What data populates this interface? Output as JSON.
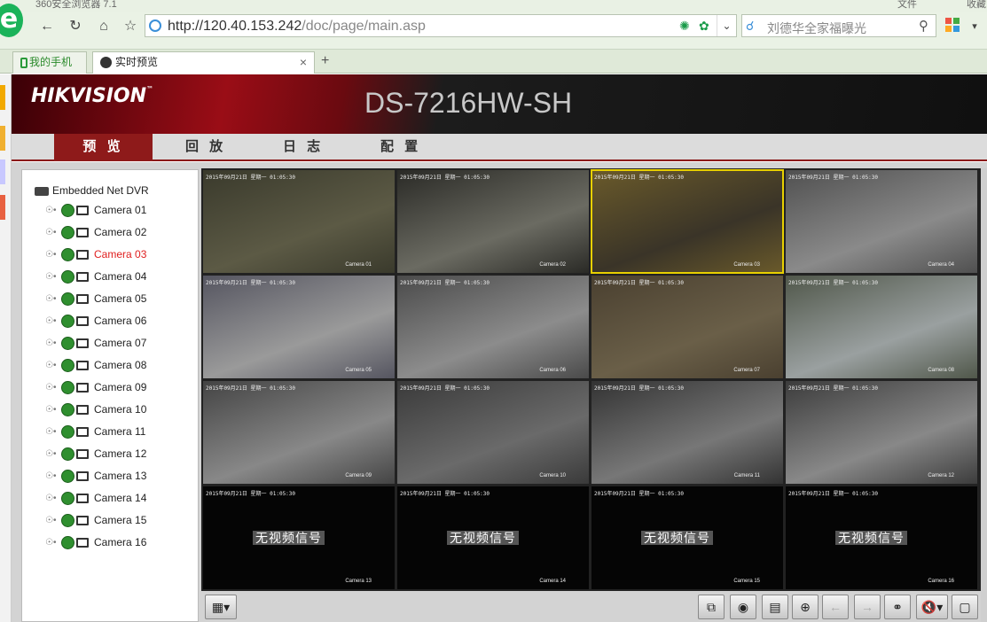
{
  "window": {
    "title": "360安全浏览器 7.1",
    "menu": [
      "文件",
      "收藏"
    ]
  },
  "toolbar": {
    "url_host": "http://120.40.153.242",
    "url_path": "/doc/page/main.asp",
    "search_placeholder": "刘德华全家福曝光"
  },
  "tabs": [
    {
      "label": "我的手机"
    },
    {
      "label": "实时预览"
    }
  ],
  "dvr": {
    "brand": "HIKVISION",
    "model": "DS-7216HW-SH",
    "nav": [
      "预 览",
      "回 放",
      "日 志",
      "配 置"
    ],
    "active_nav": 0,
    "tree_root": "Embedded Net DVR",
    "cameras": [
      "Camera 01",
      "Camera 02",
      "Camera 03",
      "Camera 04",
      "Camera 05",
      "Camera 06",
      "Camera 07",
      "Camera 08",
      "Camera 09",
      "Camera 10",
      "Camera 11",
      "Camera 12",
      "Camera 13",
      "Camera 14",
      "Camera 15",
      "Camera 16"
    ],
    "selected_camera": 2,
    "no_signal_text": "无视频信号",
    "timestamp_text": "2015年09月21日 星期一 01:05:30"
  },
  "colors": {
    "brand_red": "#8e1a1a",
    "selected_outline": "#e8d000",
    "camera_selected_text": "#e02020"
  }
}
